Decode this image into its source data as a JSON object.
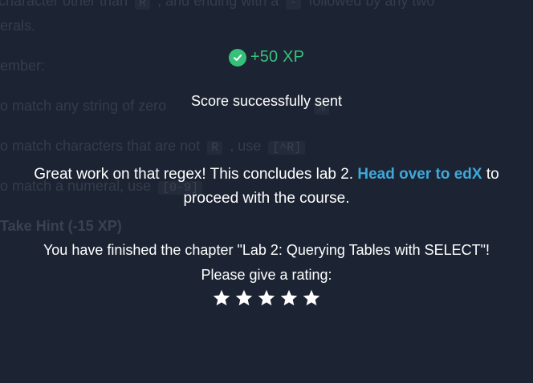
{
  "background": {
    "line1_a": "character other than",
    "line1_code1": "R",
    "line1_b": ", and ending with a",
    "line1_code2": "-",
    "line1_c": "followed by any two",
    "line2": "erals.",
    "line3": "ember:",
    "line4_a": "o match any string of zero",
    "line4_code": "%",
    "line5_a": "o match characters that are not",
    "line5_code1": "R",
    "line5_b": ", use",
    "line5_code2": "[^R]",
    "line6_a": "o match a numeral, use",
    "line6_code": "[0-9]",
    "hint": "Take Hint (-15 XP)"
  },
  "xp": {
    "label": "+50 XP",
    "color": "#36c17a",
    "icon": "check-circle-icon"
  },
  "score_status": "Score successfully sent",
  "message": {
    "before_link": "Great work on that regex! This concludes lab 2. ",
    "link_text": "Head over to edX",
    "after_link": " to proceed with the course.",
    "link_color": "#3ea8d9"
  },
  "chapter_finished": "You have finished the chapter \"Lab 2: Querying Tables with SELECT\"!",
  "rating": {
    "prompt": "Please give a rating:",
    "max_stars": 5,
    "icon": "star-icon"
  }
}
